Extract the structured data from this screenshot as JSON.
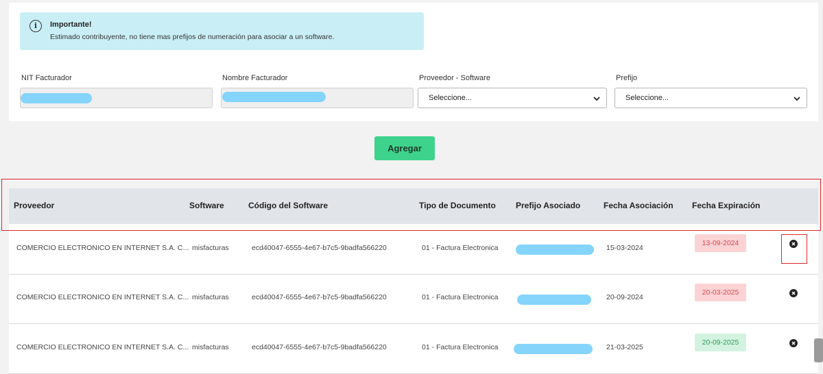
{
  "alert": {
    "title": "Importante!",
    "message": "Estimado contribuyente, no tiene mas prefijos de numeración para asociar a un software.",
    "icon": "info-icon"
  },
  "form": {
    "nit_label": "NIT Facturador",
    "nombre_label": "Nombre Facturador",
    "proveedor_label": "Proveedor - Software",
    "proveedor_value": "Seleccione...",
    "prefijo_label": "Prefijo",
    "prefijo_value": "Seleccione..."
  },
  "add_button": "Agregar",
  "table": {
    "headers": [
      "Proveedor",
      "Software",
      "Código del Software",
      "Tipo de Documento",
      "Prefijo Asociado",
      "Fecha Asociación",
      "Fecha Expiración"
    ],
    "rows": [
      {
        "proveedor": "COMERCIO ELECTRONICO EN INTERNET S.A. C...",
        "software": "misfacturas",
        "codigo": "ecd40047-6555-4e67-b7c5-9badfa566220",
        "tipo": "01 - Factura Electronica",
        "fecha_asociacion": "15-03-2024",
        "fecha_expiracion": "13-09-2024",
        "status": "expired"
      },
      {
        "proveedor": "COMERCIO ELECTRONICO EN INTERNET S.A. C...",
        "software": "misfacturas",
        "codigo": "ecd40047-6555-4e67-b7c5-9badfa566220",
        "tipo": "01 - Factura Electronica",
        "fecha_asociacion": "20-09-2024",
        "fecha_expiracion": "20-03-2025",
        "status": "expired"
      },
      {
        "proveedor": "COMERCIO ELECTRONICO EN INTERNET S.A. C...",
        "software": "misfacturas",
        "codigo": "ecd40047-6555-4e67-b7c5-9badfa566220",
        "tipo": "01 - Factura Electronica",
        "fecha_asociacion": "21-03-2025",
        "fecha_expiracion": "20-09-2025",
        "status": "valid"
      }
    ]
  },
  "colors": {
    "alert_bg": "#c9eef6",
    "button": "#3ed38c",
    "header_bg": "#e1e5e9",
    "expired_badge": "#fbd3d5",
    "valid_badge": "#d3f3e0",
    "highlight": "#e0252b",
    "redaction": "#85d4fb"
  }
}
